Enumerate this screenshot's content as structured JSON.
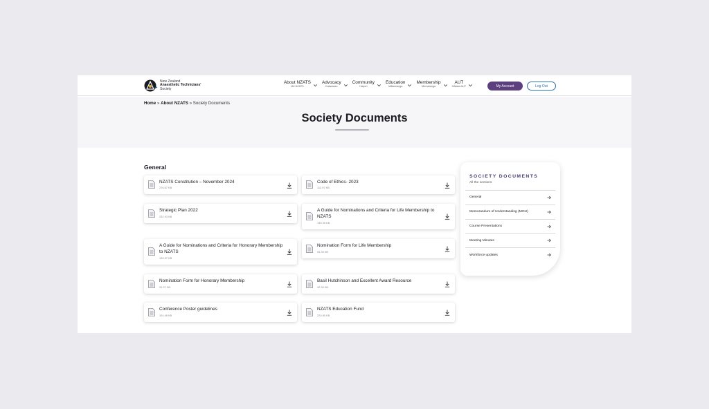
{
  "header": {
    "logo": {
      "line1": "New Zealand",
      "line2": "Anaesthetic Technicians'",
      "line3": "Society"
    },
    "nav": [
      {
        "label": "About NZATS",
        "sub": "Mō NZATS"
      },
      {
        "label": "Advocacy",
        "sub": "Kaiwawao"
      },
      {
        "label": "Community",
        "sub": "Hapori"
      },
      {
        "label": "Education",
        "sub": "Mātauranga"
      },
      {
        "label": "Membership",
        "sub": "Mematanga"
      },
      {
        "label": "AUT",
        "sub": "Hātaka AUT"
      }
    ],
    "account_label": "My Account",
    "logout_label": "Log Out"
  },
  "breadcrumb": {
    "home": "Home",
    "sep1": "»",
    "parent": "About NZATS",
    "sep2": "»",
    "current": "Society Documents"
  },
  "page_title": "Society Documents",
  "section": {
    "title": "General",
    "documents": [
      {
        "title": "NZATS Constitution – November 2024",
        "size": "276.67 KB"
      },
      {
        "title": "Code of Ethics- 2023",
        "size": "112.97 KB"
      },
      {
        "title": "Strategic Plan 2022",
        "size": "232.93 KB"
      },
      {
        "title": "A Guide for Nominations and Criteria for Life Membership to NZATS",
        "size": "139.39 KB"
      },
      {
        "title": "A Guide for Nominations and Criteria for Honorary Membership to NZATS",
        "size": "139.57 KB"
      },
      {
        "title": "Nomination Form for Life Membership",
        "size": "94.39 KB"
      },
      {
        "title": "Nomination Form for Honorary Membership",
        "size": "91.37 KB"
      },
      {
        "title": "Basil Hutchinson and Excellent Award Resource",
        "size": "42.30 KB"
      },
      {
        "title": "Conference Poster guidelines",
        "size": "104.46 KB"
      },
      {
        "title": "NZATS Education Fund",
        "size": "220.80 KB"
      }
    ]
  },
  "sidebar": {
    "title": "SOCIETY DOCUMENTS",
    "subtitle": "All the sections",
    "items": [
      {
        "label": "General"
      },
      {
        "label": "Memorandum of Understanding (MOU)"
      },
      {
        "label": "Course Presentations"
      },
      {
        "label": "Meeting Minutes"
      },
      {
        "label": "Workforce updates"
      }
    ]
  },
  "icons": {
    "document": "document-icon",
    "download": "download-icon",
    "chevron": "chevron-down-icon",
    "arrow": "arrow-right-icon"
  },
  "colors": {
    "accent_purple": "#5b3f7e",
    "link_blue": "#2a6fa6",
    "heading_purple": "#4a3a72"
  }
}
